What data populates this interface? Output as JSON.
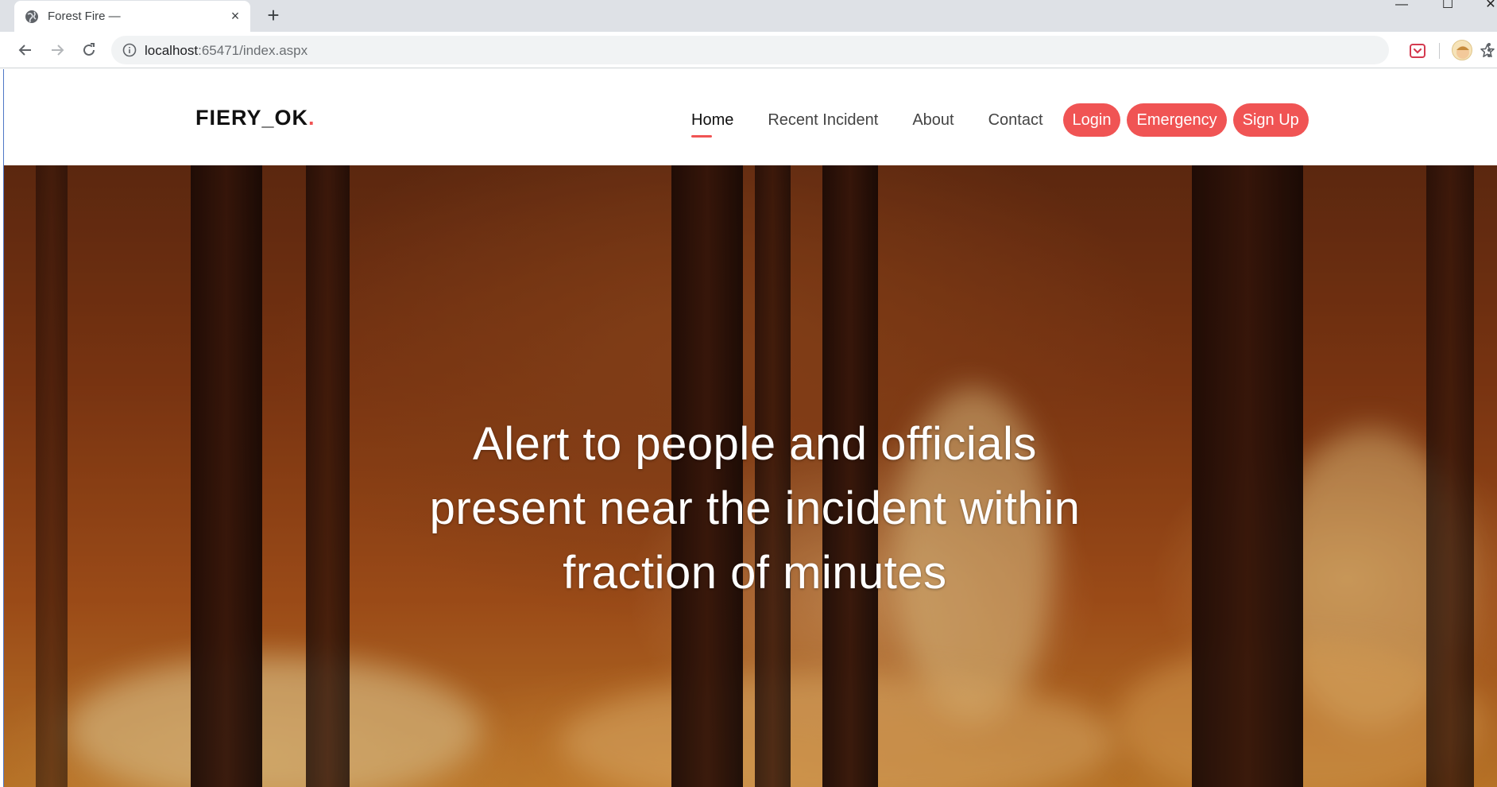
{
  "browser": {
    "tab_title": "Forest Fire —",
    "tab_close": "×",
    "new_tab": "+",
    "url_host": "localhost",
    "url_rest": ":65471/index.aspx",
    "window_min": "—",
    "window_max": "☐",
    "window_close": "✕"
  },
  "site": {
    "brand_text": "FIERY_OK",
    "brand_dot": ".",
    "brand_dot_color": "#f05454",
    "accent_color": "#f05454",
    "nav": {
      "home": "Home",
      "recent": "Recent Incident",
      "about": "About",
      "contact": "Contact",
      "login": "Login",
      "emergency": "Emergency",
      "signup": "Sign Up"
    },
    "active_nav": "Home"
  },
  "hero": {
    "line1": "Alert to people and officials",
    "line2": "present near the incident within",
    "line3": "fraction of minutes"
  }
}
